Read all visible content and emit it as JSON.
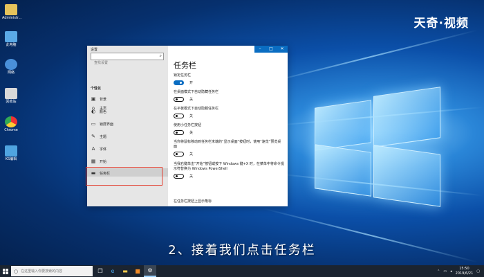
{
  "desktop_icons": [
    {
      "label": "Administr...",
      "icon": "user-folder-icon",
      "color": "#e6c35b"
    },
    {
      "label": "此电脑",
      "icon": "computer-icon",
      "color": "#5aa9e6"
    },
    {
      "label": "网络",
      "icon": "network-icon",
      "color": "#4a90d9"
    },
    {
      "label": "回收站",
      "icon": "recycle-bin-icon",
      "color": "#d9d9d9"
    },
    {
      "label": "Chrome",
      "icon": "chrome-icon",
      "color": "#e8b41f"
    },
    {
      "label": "KS编辑",
      "icon": "app-icon",
      "color": "#4fa4e0"
    }
  ],
  "watermark": "天奇·视频",
  "settings_window": {
    "title": "设置",
    "controls": {
      "minimize": "–",
      "maximize": "□",
      "close": "✕"
    },
    "accent_color": "#0a6dc2",
    "sidebar": {
      "home": "主页",
      "search_placeholder": "查找设置",
      "section_heading": "个性化",
      "items": [
        {
          "label": "背景",
          "icon": "image-icon"
        },
        {
          "label": "颜色",
          "icon": "palette-icon"
        },
        {
          "label": "锁屏界面",
          "icon": "lock-screen-icon"
        },
        {
          "label": "主题",
          "icon": "brush-icon"
        },
        {
          "label": "字体",
          "icon": "font-icon"
        },
        {
          "label": "开始",
          "icon": "start-menu-icon"
        },
        {
          "label": "任务栏",
          "icon": "taskbar-icon",
          "selected": true
        }
      ]
    },
    "main": {
      "title": "任务栏",
      "settings": [
        {
          "label": "锁定任务栏",
          "state": "开",
          "on": true
        },
        {
          "label": "在桌面模式下自动隐藏任务栏",
          "state": "关",
          "on": false
        },
        {
          "label": "在平板模式下自动隐藏任务栏",
          "state": "关",
          "on": false
        },
        {
          "label": "使用小任务栏按钮",
          "state": "关",
          "on": false
        },
        {
          "label": "当你将鼠标移动到任务栏末端的“显示桌面”按钮时，使用“速览”预览桌面",
          "state": "关",
          "on": false
        },
        {
          "label": "当我右键单击“开始”按钮或按下 Windows 键+X 时，在菜单中将命令提示符替换为 Windows PowerShell",
          "state": "关",
          "on": false
        },
        {
          "label": "在任务栏按钮上显示角标",
          "state": "",
          "on": false
        }
      ]
    }
  },
  "subtitle": "2、接着我们点击任务栏",
  "taskbar": {
    "search_placeholder": "在这里输入你要搜索的内容",
    "buttons": [
      {
        "name": "task-view",
        "icon": "task-view-icon",
        "glyph": "❐"
      },
      {
        "name": "edge",
        "icon": "edge-icon",
        "glyph": "e"
      },
      {
        "name": "file-explorer",
        "icon": "folder-icon",
        "glyph": "▬"
      },
      {
        "name": "app",
        "icon": "app-icon",
        "glyph": "■"
      },
      {
        "name": "settings",
        "icon": "gear-icon",
        "glyph": "⚙"
      }
    ],
    "clock_time": "15:50",
    "clock_date": "2019/6/21"
  }
}
